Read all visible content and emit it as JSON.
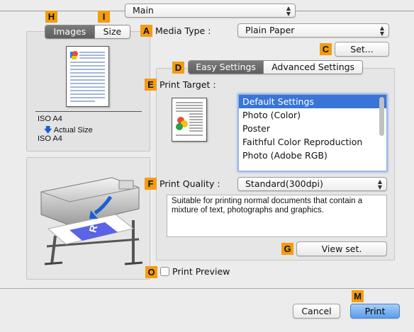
{
  "top": {
    "main_popup": "Main"
  },
  "markers": {
    "A": "A",
    "C": "C",
    "D": "D",
    "E": "E",
    "F": "F",
    "G": "G",
    "H": "H",
    "I": "I",
    "M": "M",
    "O": "O"
  },
  "preview_tabs": {
    "images": "Images",
    "size": "Size"
  },
  "paper_info": {
    "size_top": "ISO A4",
    "actual": "Actual Size",
    "size_bottom": "ISO A4"
  },
  "media_type": {
    "label": "Media Type :",
    "value": "Plain Paper"
  },
  "set_button": "Set...",
  "settings_tabs": {
    "easy": "Easy Settings",
    "advanced": "Advanced Settings"
  },
  "print_target": {
    "label": "Print Target :",
    "items": [
      "Default Settings",
      "Photo (Color)",
      "Poster",
      "Faithful Color Reproduction",
      "Photo (Adobe RGB)"
    ],
    "selected_index": 0
  },
  "print_quality": {
    "label": "Print Quality :",
    "value": "Standard(300dpi)",
    "description": "Suitable for printing normal documents that contain a mixture of text, photographs and graphics."
  },
  "view_set_button": "View set.",
  "print_preview": {
    "label": "Print Preview",
    "checked": false
  },
  "footer": {
    "cancel": "Cancel",
    "print": "Print"
  },
  "colors": {
    "accent_marker": "#f39c12",
    "selection": "#3875d7",
    "default_button": "#5a9ded"
  }
}
